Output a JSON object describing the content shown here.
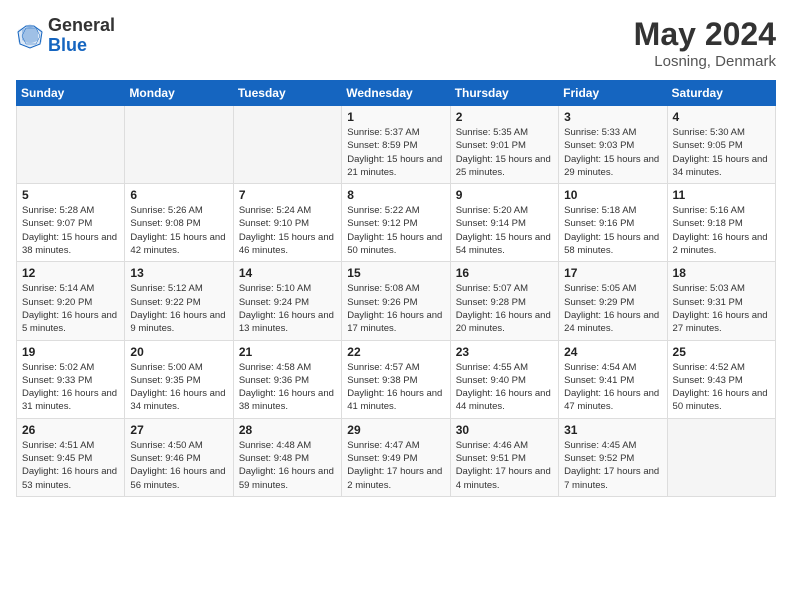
{
  "header": {
    "logo_general": "General",
    "logo_blue": "Blue",
    "title_month": "May 2024",
    "title_location": "Losning, Denmark"
  },
  "weekdays": [
    "Sunday",
    "Monday",
    "Tuesday",
    "Wednesday",
    "Thursday",
    "Friday",
    "Saturday"
  ],
  "weeks": [
    [
      {
        "day": "",
        "info": ""
      },
      {
        "day": "",
        "info": ""
      },
      {
        "day": "",
        "info": ""
      },
      {
        "day": "1",
        "info": "Sunrise: 5:37 AM\nSunset: 8:59 PM\nDaylight: 15 hours\nand 21 minutes."
      },
      {
        "day": "2",
        "info": "Sunrise: 5:35 AM\nSunset: 9:01 PM\nDaylight: 15 hours\nand 25 minutes."
      },
      {
        "day": "3",
        "info": "Sunrise: 5:33 AM\nSunset: 9:03 PM\nDaylight: 15 hours\nand 29 minutes."
      },
      {
        "day": "4",
        "info": "Sunrise: 5:30 AM\nSunset: 9:05 PM\nDaylight: 15 hours\nand 34 minutes."
      }
    ],
    [
      {
        "day": "5",
        "info": "Sunrise: 5:28 AM\nSunset: 9:07 PM\nDaylight: 15 hours\nand 38 minutes."
      },
      {
        "day": "6",
        "info": "Sunrise: 5:26 AM\nSunset: 9:08 PM\nDaylight: 15 hours\nand 42 minutes."
      },
      {
        "day": "7",
        "info": "Sunrise: 5:24 AM\nSunset: 9:10 PM\nDaylight: 15 hours\nand 46 minutes."
      },
      {
        "day": "8",
        "info": "Sunrise: 5:22 AM\nSunset: 9:12 PM\nDaylight: 15 hours\nand 50 minutes."
      },
      {
        "day": "9",
        "info": "Sunrise: 5:20 AM\nSunset: 9:14 PM\nDaylight: 15 hours\nand 54 minutes."
      },
      {
        "day": "10",
        "info": "Sunrise: 5:18 AM\nSunset: 9:16 PM\nDaylight: 15 hours\nand 58 minutes."
      },
      {
        "day": "11",
        "info": "Sunrise: 5:16 AM\nSunset: 9:18 PM\nDaylight: 16 hours\nand 2 minutes."
      }
    ],
    [
      {
        "day": "12",
        "info": "Sunrise: 5:14 AM\nSunset: 9:20 PM\nDaylight: 16 hours\nand 5 minutes."
      },
      {
        "day": "13",
        "info": "Sunrise: 5:12 AM\nSunset: 9:22 PM\nDaylight: 16 hours\nand 9 minutes."
      },
      {
        "day": "14",
        "info": "Sunrise: 5:10 AM\nSunset: 9:24 PM\nDaylight: 16 hours\nand 13 minutes."
      },
      {
        "day": "15",
        "info": "Sunrise: 5:08 AM\nSunset: 9:26 PM\nDaylight: 16 hours\nand 17 minutes."
      },
      {
        "day": "16",
        "info": "Sunrise: 5:07 AM\nSunset: 9:28 PM\nDaylight: 16 hours\nand 20 minutes."
      },
      {
        "day": "17",
        "info": "Sunrise: 5:05 AM\nSunset: 9:29 PM\nDaylight: 16 hours\nand 24 minutes."
      },
      {
        "day": "18",
        "info": "Sunrise: 5:03 AM\nSunset: 9:31 PM\nDaylight: 16 hours\nand 27 minutes."
      }
    ],
    [
      {
        "day": "19",
        "info": "Sunrise: 5:02 AM\nSunset: 9:33 PM\nDaylight: 16 hours\nand 31 minutes."
      },
      {
        "day": "20",
        "info": "Sunrise: 5:00 AM\nSunset: 9:35 PM\nDaylight: 16 hours\nand 34 minutes."
      },
      {
        "day": "21",
        "info": "Sunrise: 4:58 AM\nSunset: 9:36 PM\nDaylight: 16 hours\nand 38 minutes."
      },
      {
        "day": "22",
        "info": "Sunrise: 4:57 AM\nSunset: 9:38 PM\nDaylight: 16 hours\nand 41 minutes."
      },
      {
        "day": "23",
        "info": "Sunrise: 4:55 AM\nSunset: 9:40 PM\nDaylight: 16 hours\nand 44 minutes."
      },
      {
        "day": "24",
        "info": "Sunrise: 4:54 AM\nSunset: 9:41 PM\nDaylight: 16 hours\nand 47 minutes."
      },
      {
        "day": "25",
        "info": "Sunrise: 4:52 AM\nSunset: 9:43 PM\nDaylight: 16 hours\nand 50 minutes."
      }
    ],
    [
      {
        "day": "26",
        "info": "Sunrise: 4:51 AM\nSunset: 9:45 PM\nDaylight: 16 hours\nand 53 minutes."
      },
      {
        "day": "27",
        "info": "Sunrise: 4:50 AM\nSunset: 9:46 PM\nDaylight: 16 hours\nand 56 minutes."
      },
      {
        "day": "28",
        "info": "Sunrise: 4:48 AM\nSunset: 9:48 PM\nDaylight: 16 hours\nand 59 minutes."
      },
      {
        "day": "29",
        "info": "Sunrise: 4:47 AM\nSunset: 9:49 PM\nDaylight: 17 hours\nand 2 minutes."
      },
      {
        "day": "30",
        "info": "Sunrise: 4:46 AM\nSunset: 9:51 PM\nDaylight: 17 hours\nand 4 minutes."
      },
      {
        "day": "31",
        "info": "Sunrise: 4:45 AM\nSunset: 9:52 PM\nDaylight: 17 hours\nand 7 minutes."
      },
      {
        "day": "",
        "info": ""
      }
    ]
  ]
}
